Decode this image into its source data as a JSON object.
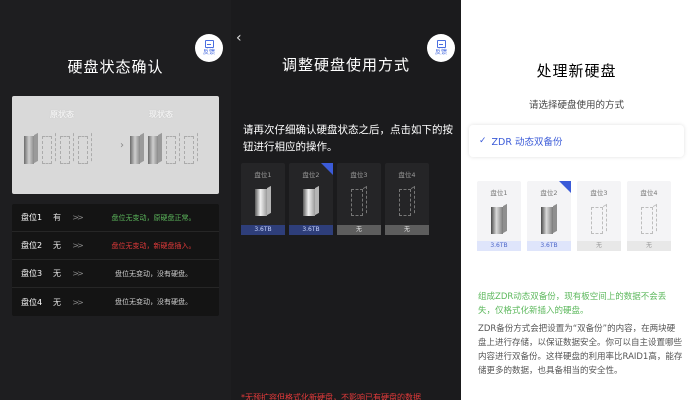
{
  "feedback_label": "反馈",
  "panel1": {
    "title": "硬盘状态确认",
    "diagram": {
      "left_label": "原状态",
      "right_label": "现状态"
    },
    "rows": [
      {
        "slot": "盘位1",
        "has": "有",
        "arrow": ">>",
        "desc": "盘位无变动，原硬盘正常。",
        "color": "#5cb85c"
      },
      {
        "slot": "盘位2",
        "has": "无",
        "arrow": ">>",
        "desc": "盘位无变动，新硬盘插入。",
        "color": "#e23a3a"
      },
      {
        "slot": "盘位3",
        "has": "无",
        "arrow": ">>",
        "desc": "盘位无变动，没有硬盘。",
        "color": "#d0d0d0"
      },
      {
        "slot": "盘位4",
        "has": "无",
        "arrow": ">>",
        "desc": "盘位无变动，没有硬盘。",
        "color": "#d0d0d0"
      }
    ]
  },
  "panel2": {
    "back_icon": "‹",
    "title": "调整硬盘使用方式",
    "instruction": "请再次仔细确认硬盘状态之后，点击如下的按钮进行相应的操作。",
    "slots": [
      {
        "name": "盘位1",
        "cap": "3.6TB",
        "filled": true,
        "new": false
      },
      {
        "name": "盘位2",
        "cap": "3.6TB",
        "filled": true,
        "new": true
      },
      {
        "name": "盘位3",
        "cap": "无",
        "filled": false,
        "new": false
      },
      {
        "name": "盘位4",
        "cap": "无",
        "filled": false,
        "new": false
      }
    ],
    "warning": "*无预扩容但格式化新硬盘，不影响已有硬盘的数据"
  },
  "panel3": {
    "title": "处理新硬盘",
    "subtitle": "请选择硬盘使用的方式",
    "option_check": "✓",
    "option_label": "ZDR 动态双备份",
    "slots": [
      {
        "name": "盘位1",
        "cap": "3.6TB",
        "filled": true,
        "new": false
      },
      {
        "name": "盘位2",
        "cap": "3.6TB",
        "filled": true,
        "new": true
      },
      {
        "name": "盘位3",
        "cap": "无",
        "filled": false,
        "new": false
      },
      {
        "name": "盘位4",
        "cap": "无",
        "filled": false,
        "new": false
      }
    ],
    "green_note": "组成ZDR动态双备份，现有板空间上的数据不会丢失，仅格式化新插入的硬盘。",
    "description": "ZDR备份方式会把设置为“双备份”的内容，在两块硬盘上进行存储，以保证数据安全。你可以自主设置哪些内容进行双备份。这样硬盘的利用率比RAID1高，能存储更多的数据，也具备相当的安全性。"
  },
  "colors": {
    "accent": "#3b5bd8",
    "green": "#5cb85c",
    "red": "#e23a3a"
  }
}
